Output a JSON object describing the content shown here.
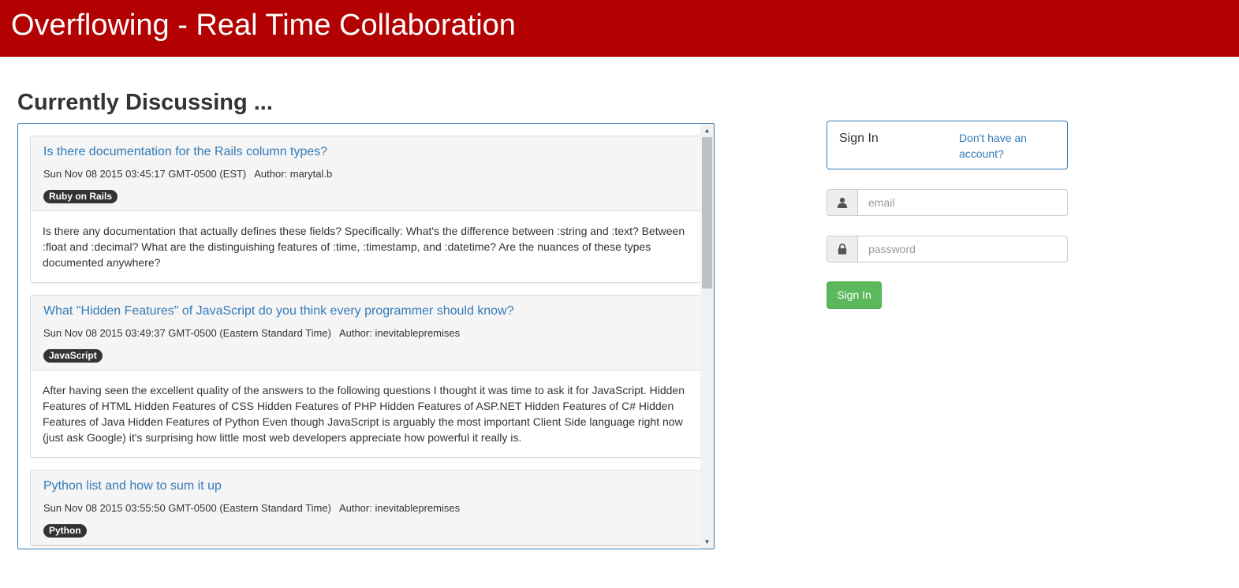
{
  "app": {
    "title": "Overflowing - Real Time Collaboration",
    "brand_color": "#b30000"
  },
  "main": {
    "heading": "Currently Discussing ...",
    "questions": [
      {
        "title": "Is there documentation for the Rails column types?",
        "date": "Sun Nov 08 2015 03:45:17 GMT-0500 (EST)",
        "author": "Author: marytal.b",
        "tag": "Ruby on Rails",
        "body": "Is there any documentation that actually defines these fields? Specifically: What's the difference between :string and :text? Between :float and :decimal? What are the distinguishing features of :time, :timestamp, and :datetime? Are the nuances of these types documented anywhere?"
      },
      {
        "title": "What \"Hidden Features\" of JavaScript do you think every programmer should know?",
        "date": "Sun Nov 08 2015 03:49:37 GMT-0500 (Eastern Standard Time)",
        "author": "Author: inevitablepremises",
        "tag": "JavaScript",
        "body": "After having seen the excellent quality of the answers to the following questions I thought it was time to ask it for JavaScript. Hidden Features of HTML Hidden Features of CSS Hidden Features of PHP Hidden Features of ASP.NET Hidden Features of C# Hidden Features of Java Hidden Features of Python Even though JavaScript is arguably the most important Client Side language right now (just ask Google) it's surprising how little most web developers appreciate how powerful it really is."
      },
      {
        "title": "Python list and how to sum it up",
        "date": "Sun Nov 08 2015 03:55:50 GMT-0500 (Eastern Standard Time)",
        "author": "Author: inevitablepremises",
        "tag": "Python",
        "body": ""
      }
    ]
  },
  "sidebar": {
    "signin_label": "Sign In",
    "signup_link": "Don't have an account?",
    "email_placeholder": "email",
    "password_placeholder": "password",
    "signin_button": "Sign In",
    "email_icon": "user-icon",
    "password_icon": "lock-icon",
    "button_color": "#5cb85c",
    "link_color": "#337ab7"
  }
}
